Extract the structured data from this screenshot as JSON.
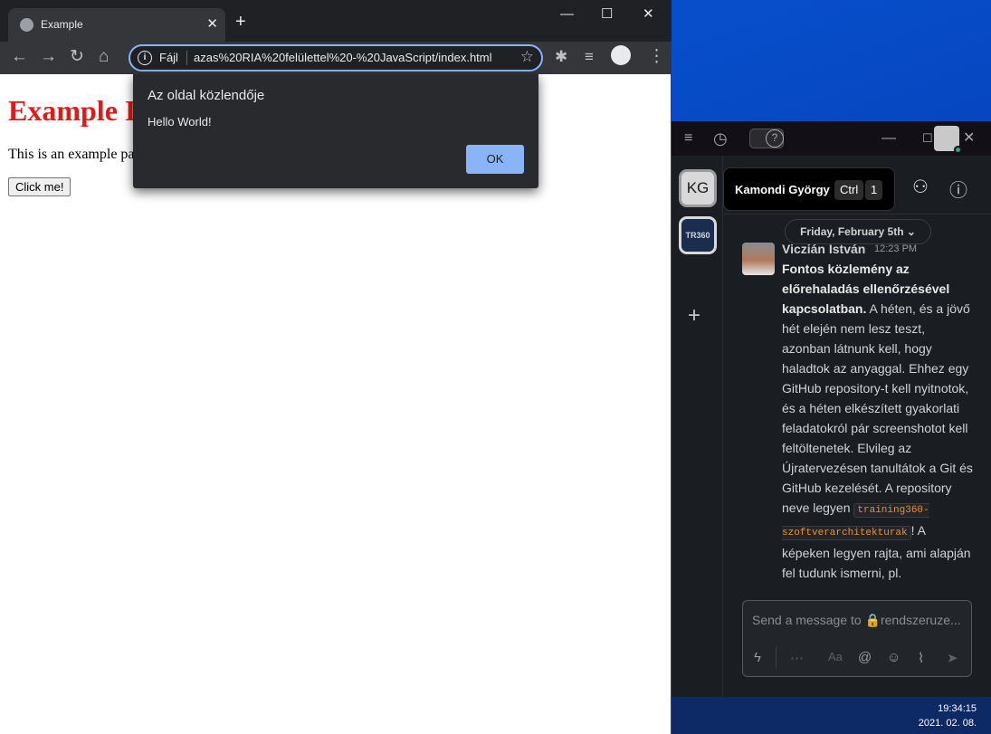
{
  "browser": {
    "tab_title": "Example",
    "tab_close": "✕",
    "new_tab": "+",
    "window_controls": {
      "minimize": "—",
      "maximize": "☐",
      "close": "✕"
    },
    "omnibox": {
      "scheme_label": "Fájl",
      "url_text": "‪azas%20RIA%20felülettel%20-%20JavaScript/index.html‬"
    },
    "page": {
      "heading": "Example I",
      "paragraph": "This is an example pa",
      "button_label": "Click me!"
    },
    "alert": {
      "title": "Az oldal közlendője",
      "message": "Hello World!",
      "ok_label": "OK"
    }
  },
  "slack": {
    "workspaces": [
      {
        "initials": "KG",
        "name": "Kamondi György"
      },
      {
        "initials": "TR360",
        "name": ""
      }
    ],
    "tooltip": {
      "name": "Kamondi György",
      "shortcut_mod": "Ctrl",
      "shortcut_key": "1"
    },
    "date_divider": "Friday, February 5th ⌄",
    "message": {
      "author": "Viczián István",
      "time": "12:23 PM",
      "bold_intro": "Fontos közlemény az előrehaladás ellenőrzésével kapcsolatban.",
      "text_1": " A héten, és a jövő hét elején nem lesz teszt, azonban látnunk kell, hogy haladtok az anyaggal. Ehhez egy GitHub repository-t kell nyitnotok, és a héten elkészített gyakorlati feladatokról pár screenshotot kell feltöltenetek. Elvileg az Újratervezésen tanultátok a Git és GitHub kezelését. A repository neve legyen ",
      "code": "training360-szoftverarchitekturak",
      "text_2": "! A képeken legyen rajta, ami alapján fel tudunk ismerni, pl."
    },
    "composer_placeholder": "Send a message to 🔒rendszeruze..."
  },
  "taskbar": {
    "time": "19:34:15",
    "date": "2021. 02. 08."
  },
  "colors": {
    "heading_red": "#e01b1b",
    "alert_button": "#8ab4f8",
    "code_orange": "#e8912d"
  }
}
